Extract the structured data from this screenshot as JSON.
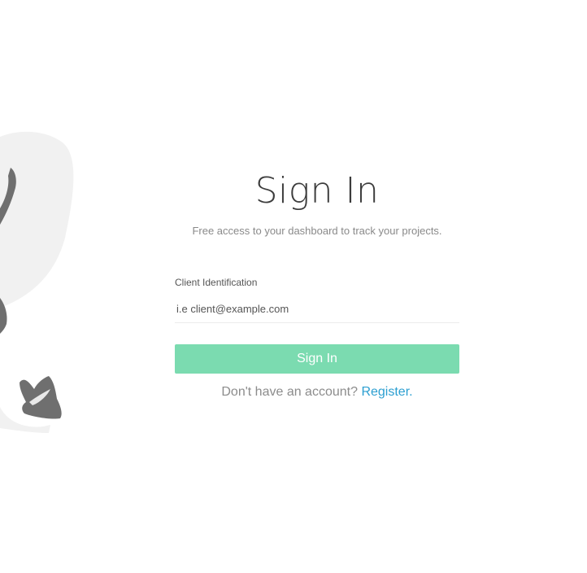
{
  "signin": {
    "title": "Sign In",
    "subtitle": "Free access to your dashboard to track your projects.",
    "client_label": "Client Identification",
    "client_placeholder": "i.e client@example.com",
    "client_value": "",
    "submit_label": "Sign In",
    "register_prompt": "Don't have an account?",
    "register_link": "Register",
    "register_suffix": "."
  },
  "colors": {
    "button_bg": "#7bdbb0",
    "link": "#2c9fd1",
    "illustration_blob": "#f1f1f1",
    "illustration_figure": "#6f6f6f"
  },
  "icons": {
    "illustration": "person-illustration"
  }
}
